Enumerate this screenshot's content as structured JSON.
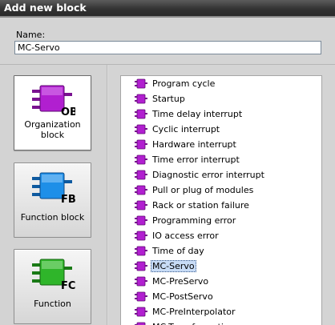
{
  "dialog": {
    "title": "Add new block"
  },
  "name_field": {
    "label": "Name:",
    "value": "MC-Servo"
  },
  "block_types": [
    {
      "label": "Organization block",
      "badge": "OB",
      "color": "#b11fd0",
      "selected": true
    },
    {
      "label": "Function block",
      "badge": "FB",
      "color": "#1e8fe8",
      "selected": false
    },
    {
      "label": "Function",
      "badge": "FC",
      "color": "#2fb52a",
      "selected": false
    }
  ],
  "ob_list": {
    "selected": "MC-Servo",
    "items": [
      "Program cycle",
      "Startup",
      "Time delay interrupt",
      "Cyclic interrupt",
      "Hardware interrupt",
      "Time error interrupt",
      "Diagnostic error interrupt",
      "Pull or plug of modules",
      "Rack or station failure",
      "Programming error",
      "IO access error",
      "Time of day",
      "MC-Servo",
      "MC-PreServo",
      "MC-PostServo",
      "MC-PreInterpolator",
      "MC-Transformation"
    ]
  }
}
